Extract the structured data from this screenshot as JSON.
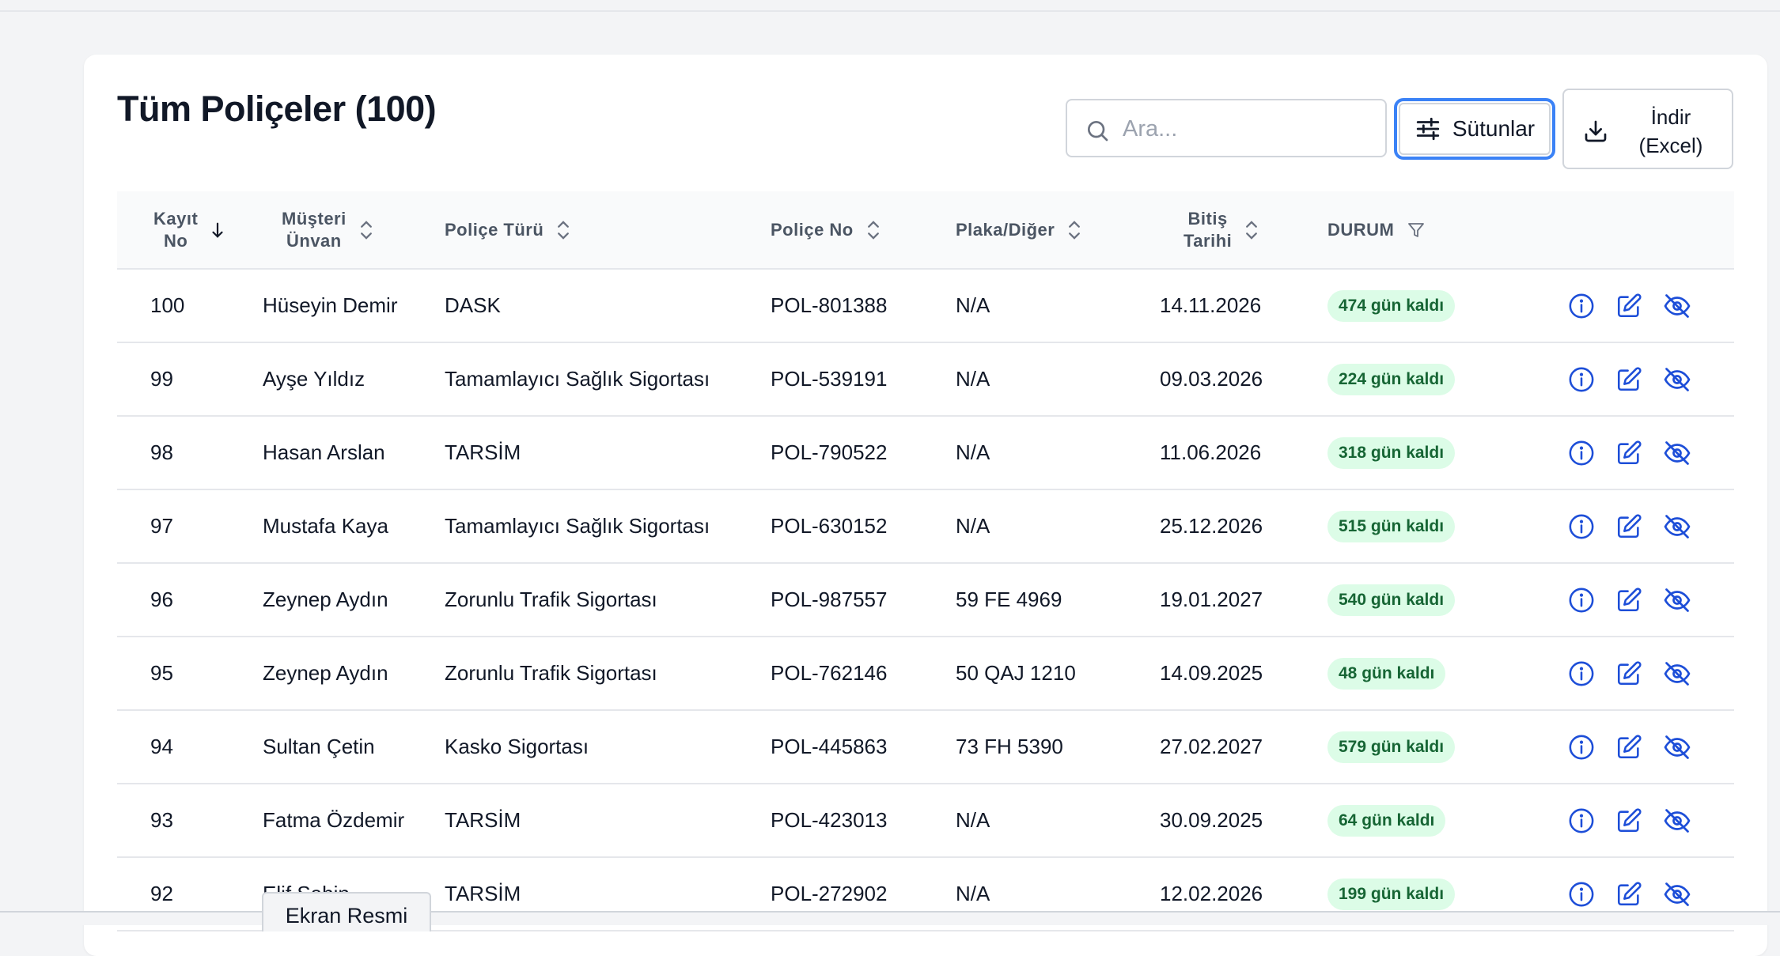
{
  "page": {
    "title": "Tüm Poliçeler (100)"
  },
  "toolbar": {
    "search_placeholder": "Ara...",
    "columns_label": "Sütunlar",
    "download_label": "İndir\n(Excel)"
  },
  "table": {
    "columns": [
      {
        "label": "Kayıt\nNo",
        "sort": "desc"
      },
      {
        "label": "Müşteri\nÜnvan",
        "sort": "none"
      },
      {
        "label": "Poliçe Türü",
        "sort": "none"
      },
      {
        "label": "Poliçe No",
        "sort": "none"
      },
      {
        "label": "Plaka/Diğer",
        "sort": "none"
      },
      {
        "label": "Bitiş\nTarihi",
        "sort": "none"
      },
      {
        "label": "DURUM",
        "filter": true
      }
    ],
    "rows": [
      {
        "no": "100",
        "customer": "Hüseyin Demir",
        "type": "DASK",
        "policy_no": "POL-801388",
        "plate": "N/A",
        "end_date": "14.11.2026",
        "status": "474 gün kaldı"
      },
      {
        "no": "99",
        "customer": "Ayşe Yıldız",
        "type": "Tamamlayıcı Sağlık Sigortası",
        "policy_no": "POL-539191",
        "plate": "N/A",
        "end_date": "09.03.2026",
        "status": "224 gün kaldı"
      },
      {
        "no": "98",
        "customer": "Hasan Arslan",
        "type": "TARSİM",
        "policy_no": "POL-790522",
        "plate": "N/A",
        "end_date": "11.06.2026",
        "status": "318 gün kaldı"
      },
      {
        "no": "97",
        "customer": "Mustafa Kaya",
        "type": "Tamamlayıcı Sağlık Sigortası",
        "policy_no": "POL-630152",
        "plate": "N/A",
        "end_date": "25.12.2026",
        "status": "515 gün kaldı"
      },
      {
        "no": "96",
        "customer": "Zeynep Aydın",
        "type": "Zorunlu Trafik Sigortası",
        "policy_no": "POL-987557",
        "plate": "59 FE 4969",
        "end_date": "19.01.2027",
        "status": "540 gün kaldı"
      },
      {
        "no": "95",
        "customer": "Zeynep Aydın",
        "type": "Zorunlu Trafik Sigortası",
        "policy_no": "POL-762146",
        "plate": "50 QAJ 1210",
        "end_date": "14.09.2025",
        "status": "48 gün kaldı"
      },
      {
        "no": "94",
        "customer": "Sultan Çetin",
        "type": "Kasko Sigortası",
        "policy_no": "POL-445863",
        "plate": "73 FH 5390",
        "end_date": "27.02.2027",
        "status": "579 gün kaldı"
      },
      {
        "no": "93",
        "customer": "Fatma Özdemir",
        "type": "TARSİM",
        "policy_no": "POL-423013",
        "plate": "N/A",
        "end_date": "30.09.2025",
        "status": "64 gün kaldı"
      },
      {
        "no": "92",
        "customer": "Elif Şahin",
        "type": "TARSİM",
        "policy_no": "POL-272902",
        "plate": "N/A",
        "end_date": "12.02.2026",
        "status": "199 gün kaldı"
      }
    ],
    "row_actions": [
      "info-icon",
      "edit-icon",
      "hide-icon"
    ]
  },
  "overlay": {
    "tab_label": "Ekran Resmi"
  },
  "colors": {
    "accent": "#1d4ed8",
    "badge_bg": "#dcfce7",
    "badge_text": "#166534"
  }
}
